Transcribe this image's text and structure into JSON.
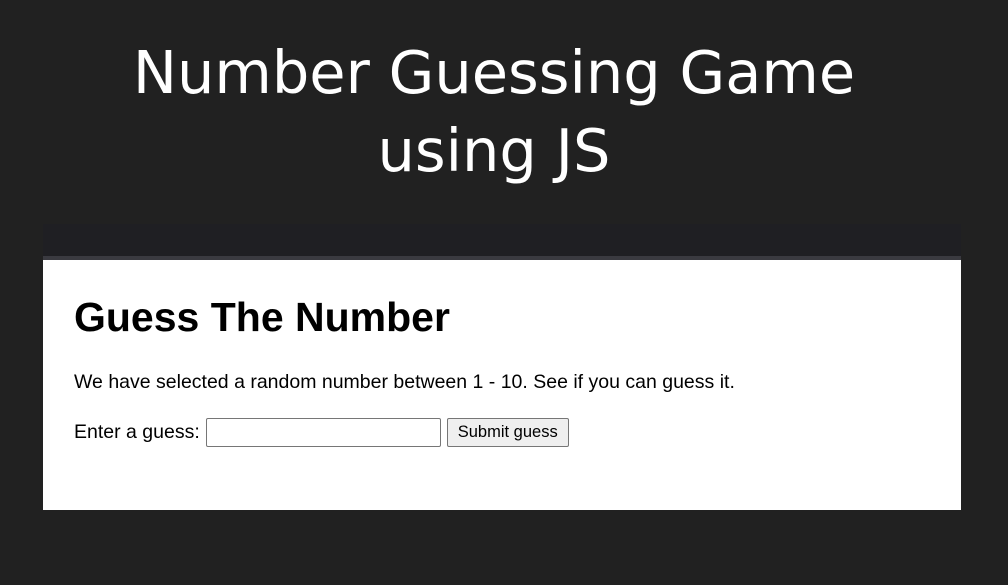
{
  "banner": {
    "title_line1": "Number Guessing Game",
    "title_line2": "using JS"
  },
  "page": {
    "heading": "Guess The Number",
    "intro": "We have selected a random number between 1 - 10. See if you can guess it.",
    "form": {
      "label": "Enter a guess:",
      "input_value": "",
      "input_placeholder": "",
      "submit_label": "Submit guess"
    }
  },
  "colors": {
    "background": "#212121",
    "banner_text": "#ffffff",
    "panel": "#ffffff",
    "panel_top_bar": "#1f1f23"
  }
}
